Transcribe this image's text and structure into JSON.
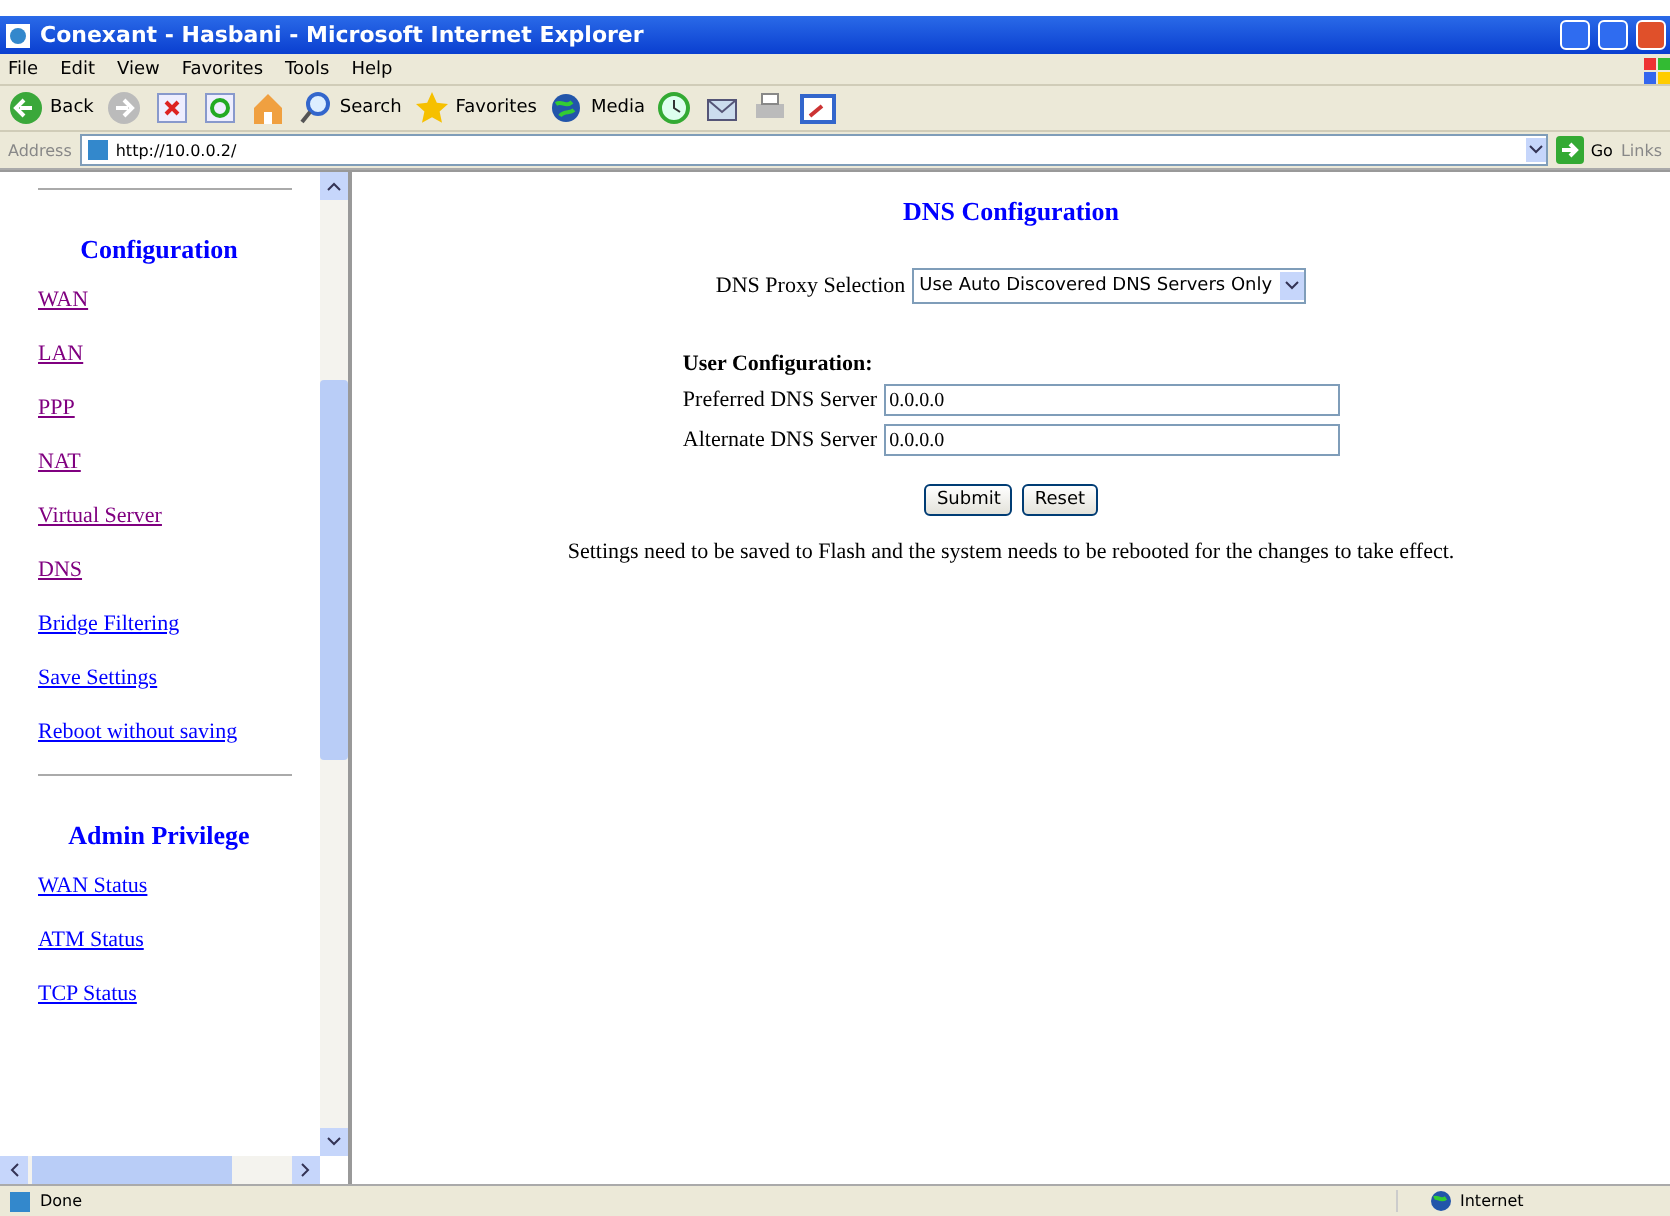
{
  "window": {
    "title": "Conexant - Hasbani - Microsoft Internet Explorer"
  },
  "menu": [
    "File",
    "Edit",
    "View",
    "Favorites",
    "Tools",
    "Help"
  ],
  "toolbar": [
    {
      "kind": "back",
      "label": "Back"
    },
    {
      "kind": "forward"
    },
    {
      "kind": "stop"
    },
    {
      "kind": "refresh"
    },
    {
      "kind": "home"
    },
    {
      "kind": "search",
      "label": "Search"
    },
    {
      "kind": "favorites",
      "label": "Favorites"
    },
    {
      "kind": "media",
      "label": "Media"
    },
    {
      "kind": "history"
    },
    {
      "kind": "mail"
    },
    {
      "kind": "print"
    },
    {
      "kind": "edit"
    }
  ],
  "address_bar": {
    "label": "Address",
    "value": "http://10.0.0.2/",
    "go": "Go",
    "links": "Links"
  },
  "sidebar": {
    "sections": [
      {
        "title": "Configuration",
        "items": [
          {
            "label": "WAN",
            "visited": true
          },
          {
            "label": "LAN",
            "visited": true
          },
          {
            "label": "PPP",
            "visited": true
          },
          {
            "label": "NAT",
            "visited": true
          },
          {
            "label": "Virtual Server",
            "visited": true
          },
          {
            "label": "DNS",
            "visited": true
          },
          {
            "label": "Bridge Filtering",
            "visited": false
          },
          {
            "label": "Save Settings",
            "visited": false
          },
          {
            "label": "Reboot without saving",
            "visited": false
          }
        ]
      },
      {
        "title": "Admin Privilege",
        "items": [
          {
            "label": "WAN Status",
            "visited": false
          },
          {
            "label": "ATM Status",
            "visited": false
          },
          {
            "label": "TCP Status",
            "visited": false
          }
        ]
      }
    ]
  },
  "main": {
    "title": "DNS Configuration",
    "proxy": {
      "label": "DNS Proxy Selection",
      "value": "Use Auto Discovered DNS Servers Only"
    },
    "user_config": {
      "heading": "User Configuration:",
      "fields": [
        {
          "label": "Preferred DNS Server",
          "value": "0.0.0.0"
        },
        {
          "label": "Alternate DNS Server",
          "value": "0.0.0.0"
        }
      ]
    },
    "buttons": [
      "Submit",
      "Reset"
    ],
    "note": "Settings need to be saved to Flash and the system needs to be rebooted for the changes to take effect."
  },
  "status_bar": {
    "text": "Done",
    "zone": "Internet"
  }
}
